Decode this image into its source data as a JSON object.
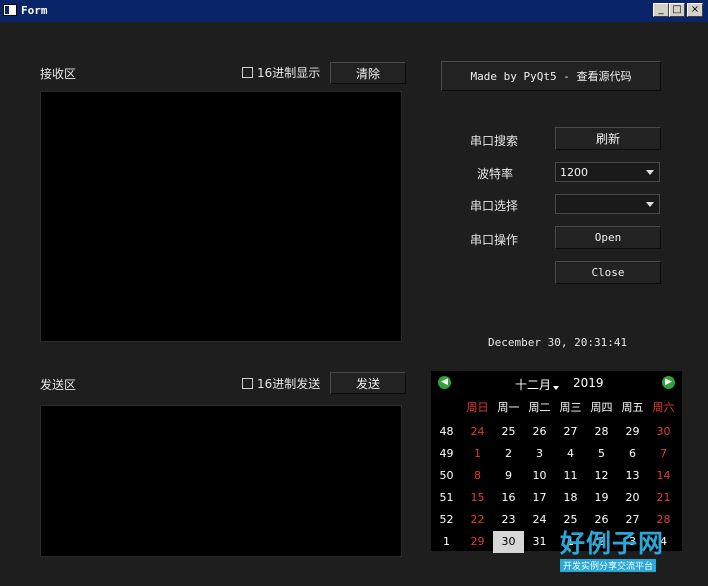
{
  "window": {
    "title": "Form",
    "minimize": "_",
    "maximize": "□",
    "close": "×"
  },
  "receive": {
    "label": "接收区",
    "hex_display_label": "16进制显示",
    "clear_button": "清除"
  },
  "send": {
    "label": "发送区",
    "hex_send_label": "16进制发送",
    "send_button": "发送"
  },
  "source_button": "Made by PyQt5 - 查看源代码",
  "serial": {
    "search_label": "串口搜索",
    "refresh_button": "刷新",
    "baud_label": "波特率",
    "baud_value": "1200",
    "port_label": "串口选择",
    "port_value": "",
    "op_label": "串口操作",
    "open_button": "Open",
    "close_button": "Close"
  },
  "datetime": "December 30, 20:31:41",
  "calendar": {
    "prev": "◀",
    "next": "▶",
    "month": "十二月",
    "year": "2019",
    "weekdays": [
      "周日",
      "周一",
      "周二",
      "周三",
      "周四",
      "周五",
      "周六"
    ],
    "weeks": [
      {
        "wk": "48",
        "days": [
          "24",
          "25",
          "26",
          "27",
          "28",
          "29",
          "30"
        ]
      },
      {
        "wk": "49",
        "days": [
          "1",
          "2",
          "3",
          "4",
          "5",
          "6",
          "7"
        ]
      },
      {
        "wk": "50",
        "days": [
          "8",
          "9",
          "10",
          "11",
          "12",
          "13",
          "14"
        ]
      },
      {
        "wk": "51",
        "days": [
          "15",
          "16",
          "17",
          "18",
          "19",
          "20",
          "21"
        ]
      },
      {
        "wk": "52",
        "days": [
          "22",
          "23",
          "24",
          "25",
          "26",
          "27",
          "28"
        ]
      },
      {
        "wk": "1",
        "days": [
          "29",
          "30",
          "31",
          "1",
          "2",
          "3",
          "4"
        ]
      }
    ],
    "selected": "30",
    "colors": {
      "weekend": "#e53935",
      "selected_bg": "#d6d6d6",
      "nav": "#2fa23a"
    }
  },
  "watermark": {
    "main": "好例子网",
    "sub": "开发实例分享交流平台"
  }
}
